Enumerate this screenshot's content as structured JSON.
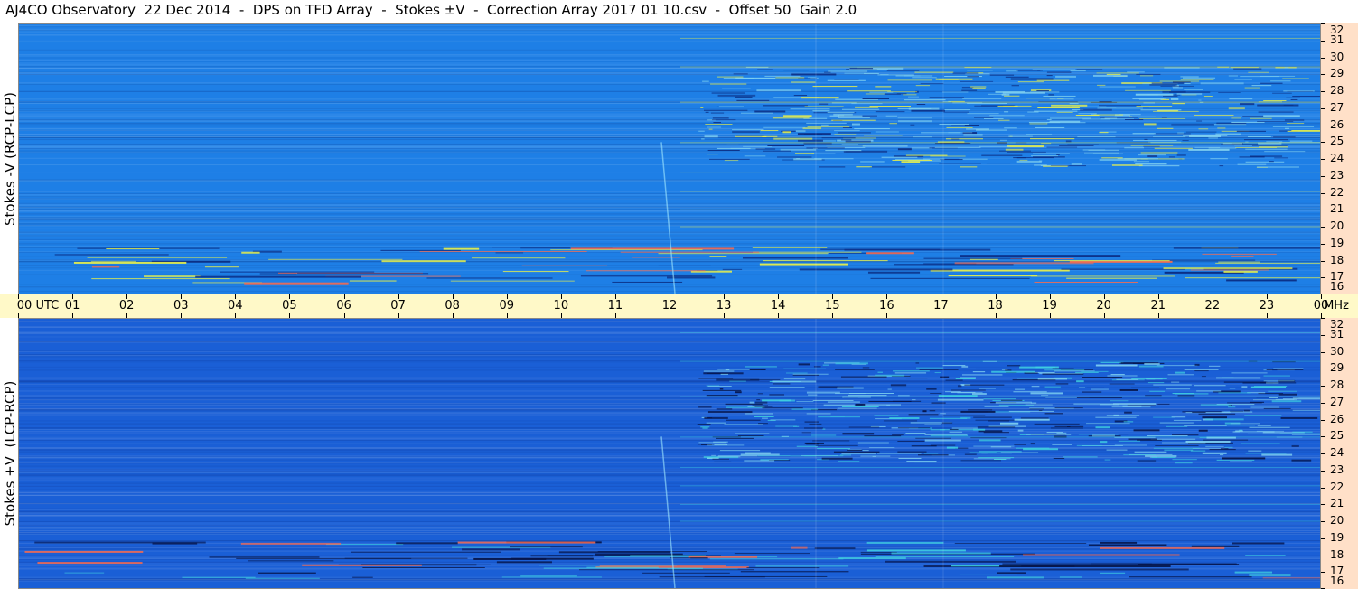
{
  "header": {
    "title": "AJ4CO Observatory  22 Dec 2014  -  DPS on TFD Array  -  Stokes ±V  -  Correction Array 2017 01 10.csv  -  Offset 50  Gain 2.0"
  },
  "chart_data": [
    {
      "type": "heatmap",
      "ylabel": "Stokes -V (RCP-LCP)",
      "y_ticks": [
        "16",
        "17",
        "18",
        "19",
        "20",
        "21",
        "22",
        "23",
        "24",
        "25",
        "26",
        "27",
        "28",
        "29",
        "30",
        "31",
        "32"
      ],
      "ylim": [
        16,
        32
      ],
      "y_unit": "MHz",
      "x_ticks": [
        "00 UTC",
        "01",
        "02",
        "03",
        "04",
        "05",
        "06",
        "07",
        "08",
        "09",
        "10",
        "11",
        "12",
        "13",
        "14",
        "15",
        "16",
        "17",
        "18",
        "19",
        "20",
        "21",
        "22",
        "23",
        "00"
      ],
      "xlim": [
        0,
        24
      ],
      "colors": {
        "base": "#1e7fe6",
        "high": "#e8f04a",
        "low": "#0a2a80"
      }
    },
    {
      "type": "heatmap",
      "ylabel": "Stokes +V  (LCP-RCP)",
      "y_ticks": [
        "16",
        "17",
        "18",
        "19",
        "20",
        "21",
        "22",
        "23",
        "24",
        "25",
        "26",
        "27",
        "28",
        "29",
        "30",
        "31",
        "32"
      ],
      "ylim": [
        16,
        32
      ],
      "y_unit": "MHz",
      "x_ticks": [
        "00 UTC",
        "01",
        "02",
        "03",
        "04",
        "05",
        "06",
        "07",
        "08",
        "09",
        "10",
        "11",
        "12",
        "13",
        "14",
        "15",
        "16",
        "17",
        "18",
        "19",
        "20",
        "21",
        "22",
        "23",
        "00"
      ],
      "xlim": [
        0,
        24
      ],
      "colors": {
        "base": "#1a5fd6",
        "high": "#40d0e0",
        "low": "#06154a"
      }
    }
  ],
  "time_axis": {
    "labels": [
      "00 UTC",
      "01",
      "02",
      "03",
      "04",
      "05",
      "06",
      "07",
      "08",
      "09",
      "10",
      "11",
      "12",
      "13",
      "14",
      "15",
      "16",
      "17",
      "18",
      "19",
      "20",
      "21",
      "22",
      "23",
      "00"
    ],
    "unit_label": "MHz"
  }
}
